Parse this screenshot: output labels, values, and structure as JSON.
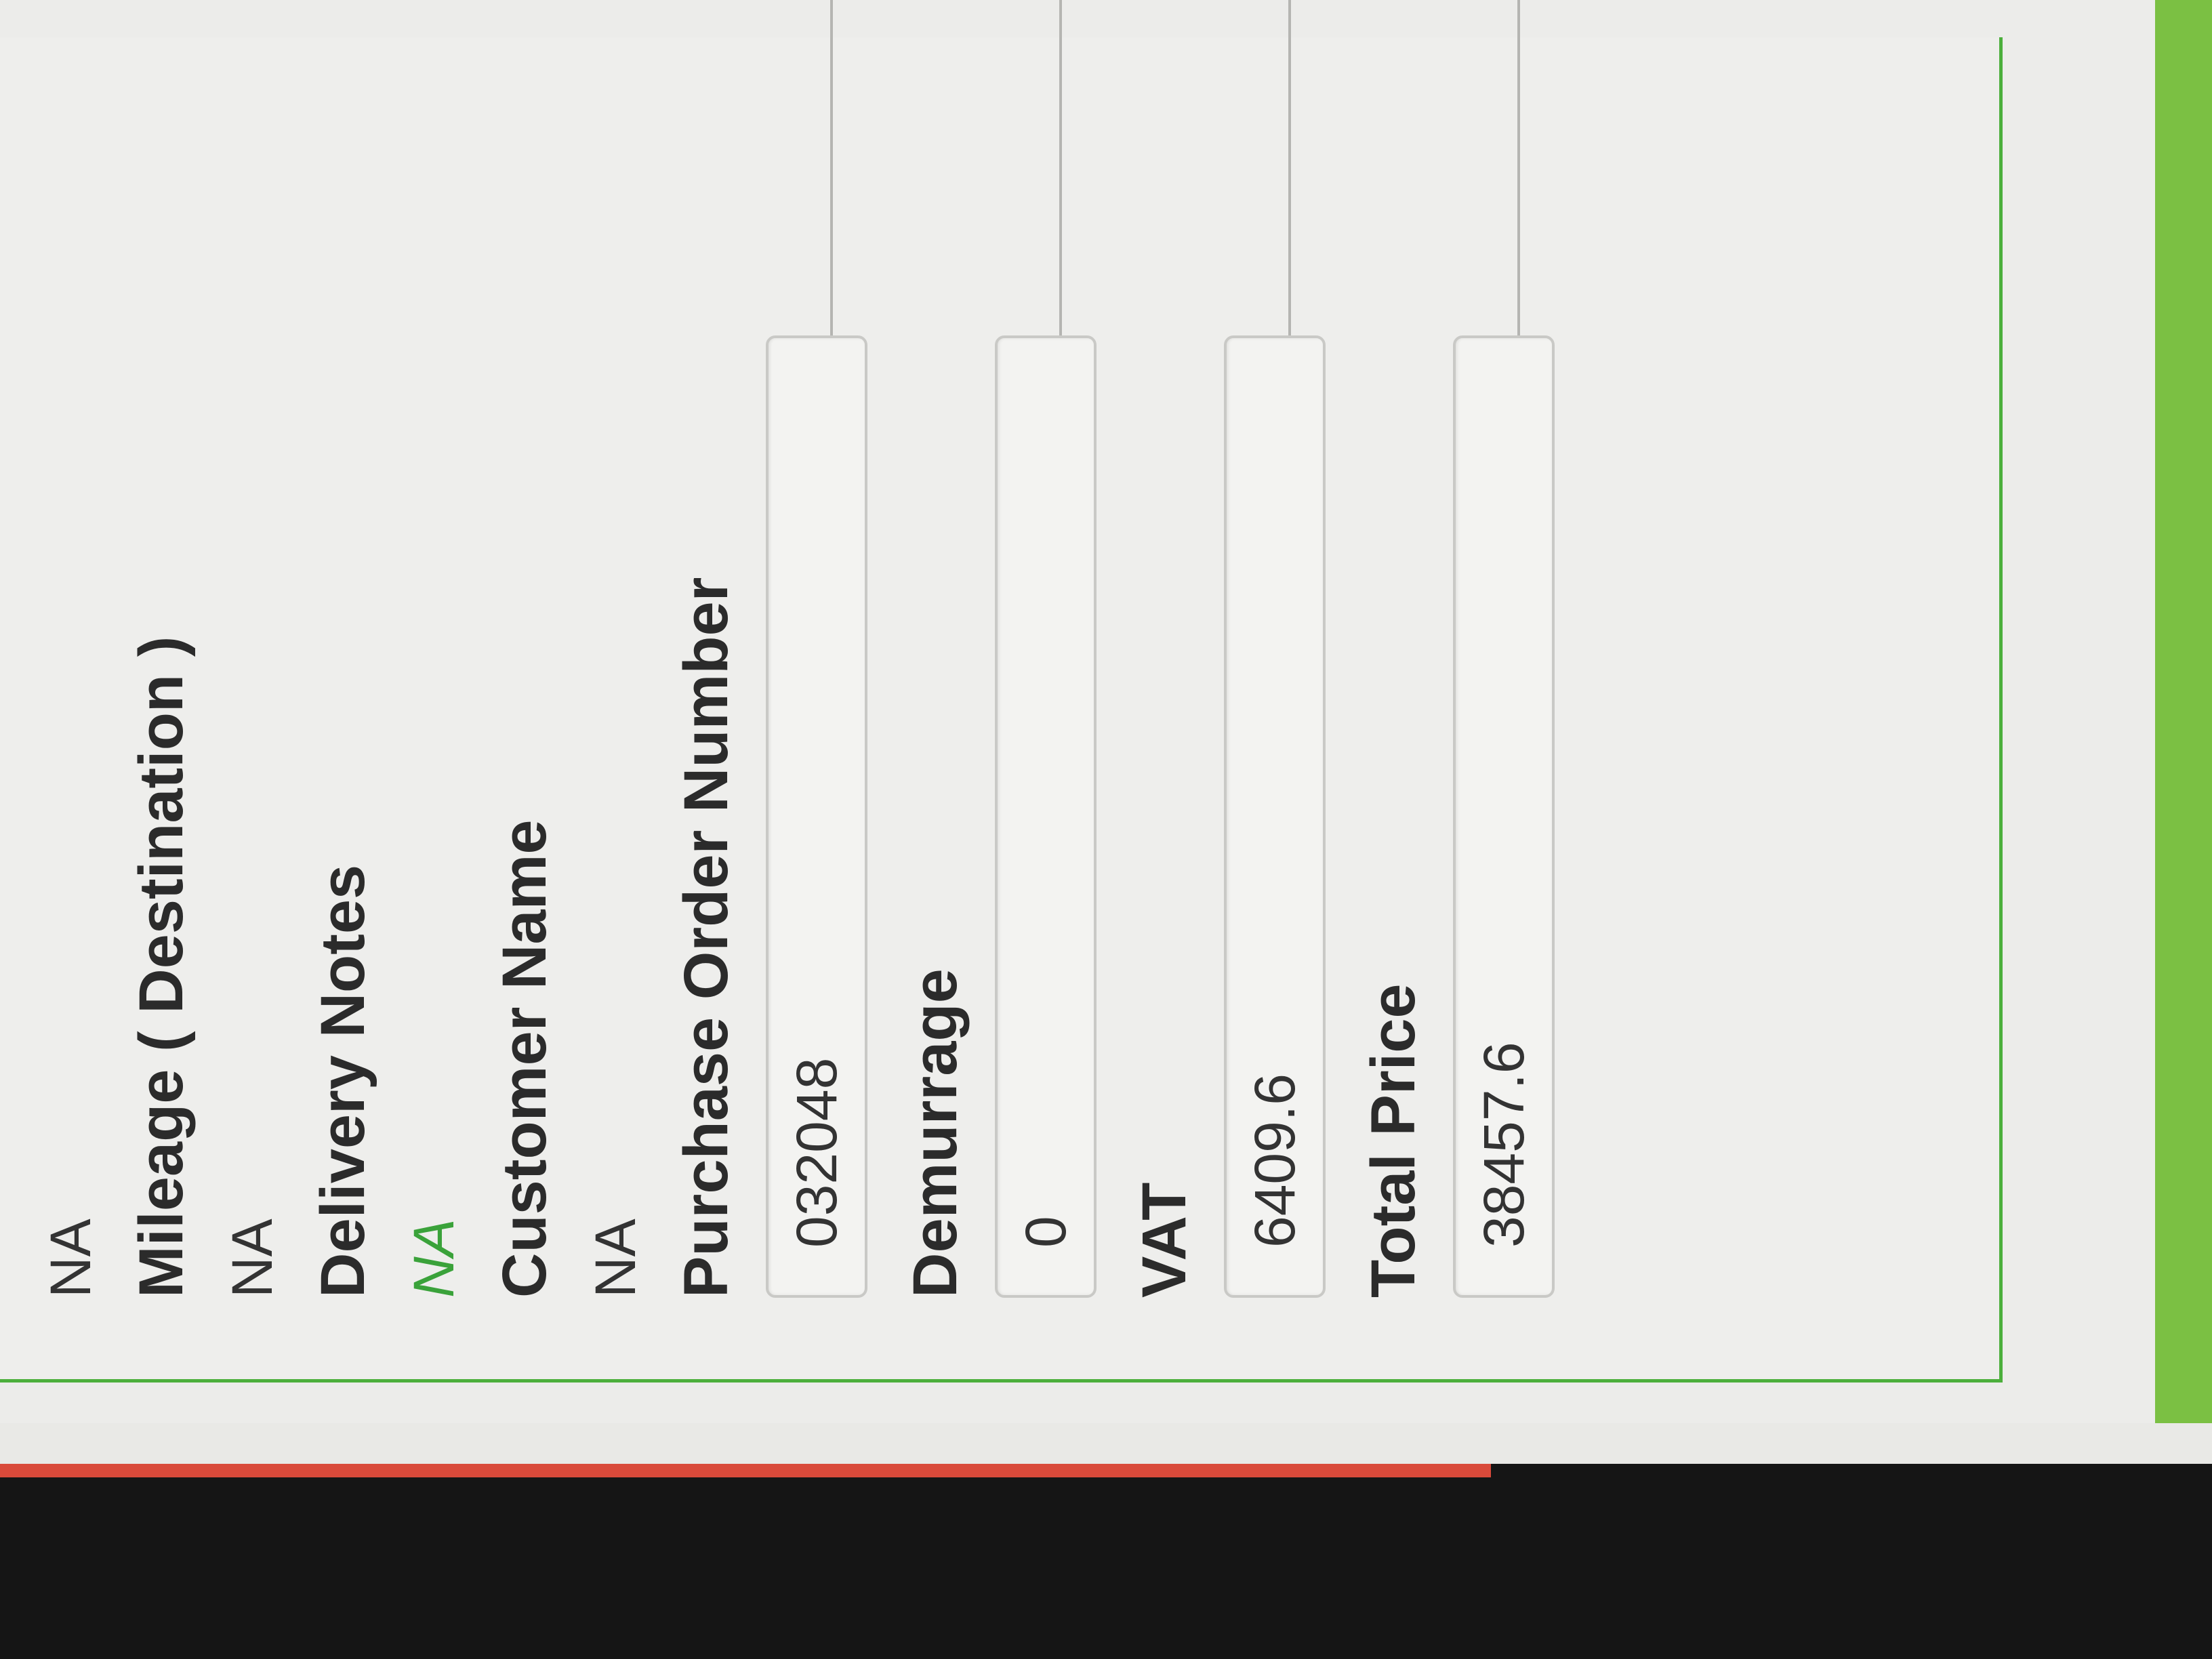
{
  "form": {
    "rows": [
      {
        "type": "value",
        "text": "NA"
      },
      {
        "type": "label",
        "text": "Mileage ( Destination )"
      },
      {
        "type": "value",
        "text": "NA"
      },
      {
        "type": "label",
        "text": "Delivery Notes"
      },
      {
        "type": "value",
        "text": "NA",
        "accent": true
      },
      {
        "type": "label",
        "text": "Customer Name"
      },
      {
        "type": "value",
        "text": "NA"
      },
      {
        "type": "label",
        "text": "Purchase Order Number"
      }
    ],
    "top_value": "NA",
    "mileage_label": "Mileage ( Destination )",
    "mileage_value": "NA",
    "delivery_notes_label": "Delivery Notes",
    "delivery_notes_value": "NA",
    "customer_name_label": "Customer Name",
    "customer_name_value": "NA",
    "po_label": "Purchase Order Number",
    "po_value": "032048",
    "demurrage_label": "Demurrage",
    "demurrage_value": "0",
    "vat_label": "VAT",
    "vat_value": "6409.6",
    "total_price_label": "Total Price",
    "total_price_value": "38457.6"
  },
  "colors": {
    "accent_green": "#3aa23a",
    "border_green": "#4caf3c",
    "bar_green": "#7bc043",
    "bezel_red": "#d94a3a"
  }
}
